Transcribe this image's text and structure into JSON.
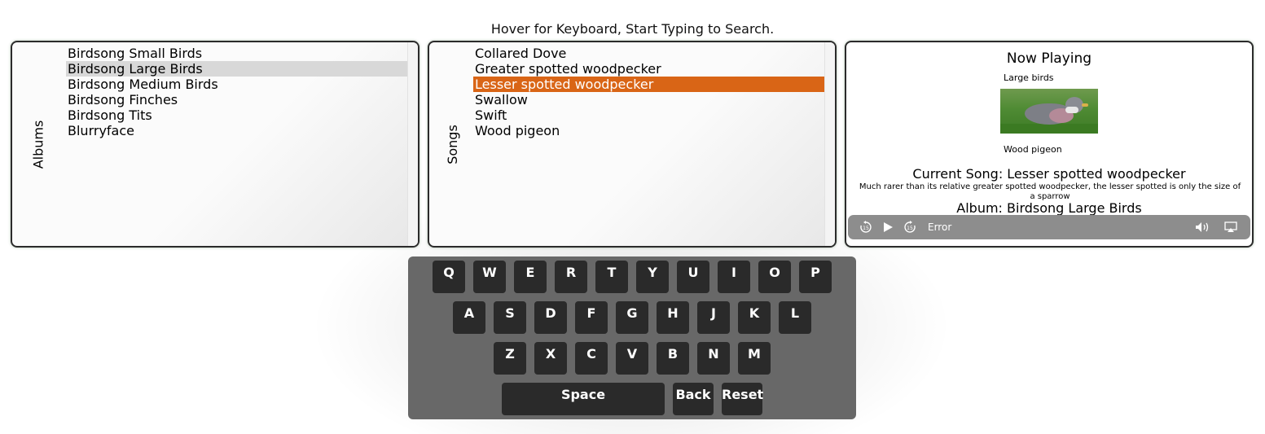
{
  "hint": "Hover for Keyboard, Start Typing to Search.",
  "albums": {
    "label": "Albums",
    "items": [
      "Birdsong Small Birds",
      "Birdsong Large Birds",
      "Birdsong Medium Birds",
      "Birdsong Finches",
      "Birdsong Tits",
      "Blurryface"
    ],
    "selected": "Birdsong Large Birds"
  },
  "songs": {
    "label": "Songs",
    "items": [
      "Collared Dove",
      "Greater spotted woodpecker",
      "Lesser spotted woodpecker",
      "Swallow",
      "Swift",
      "Wood pigeon"
    ],
    "selected": "Lesser spotted woodpecker"
  },
  "now_playing": {
    "title": "Now Playing",
    "album_small": "Large birds",
    "image_caption": "Wood pigeon",
    "current_song": "Current Song: Lesser spotted woodpecker",
    "description": "Much rarer than its relative greater spotted woodpecker, the lesser spotted is only the size of a sparrow",
    "album": "Album: Birdsong Large Birds",
    "controls": {
      "rewind_icon": "rewind-15-icon",
      "play_icon": "play-icon",
      "forward_icon": "forward-15-icon",
      "status": "Error",
      "volume_icon": "volume-icon",
      "airplay_icon": "airplay-icon"
    }
  },
  "keyboard": {
    "rows": [
      [
        "Q",
        "W",
        "E",
        "R",
        "T",
        "Y",
        "U",
        "I",
        "O",
        "P"
      ],
      [
        "A",
        "S",
        "D",
        "F",
        "G",
        "H",
        "J",
        "K",
        "L"
      ],
      [
        "Z",
        "X",
        "C",
        "V",
        "B",
        "N",
        "M"
      ]
    ],
    "space": "Space",
    "back": "Back",
    "reset": "Reset"
  },
  "colors": {
    "selected_song": "#d96516",
    "selected_album": "#d8d8d8",
    "keyboard_bg": "#686868",
    "key_bg": "#2a2a2a",
    "controls_bg": "#8d8d8d"
  }
}
